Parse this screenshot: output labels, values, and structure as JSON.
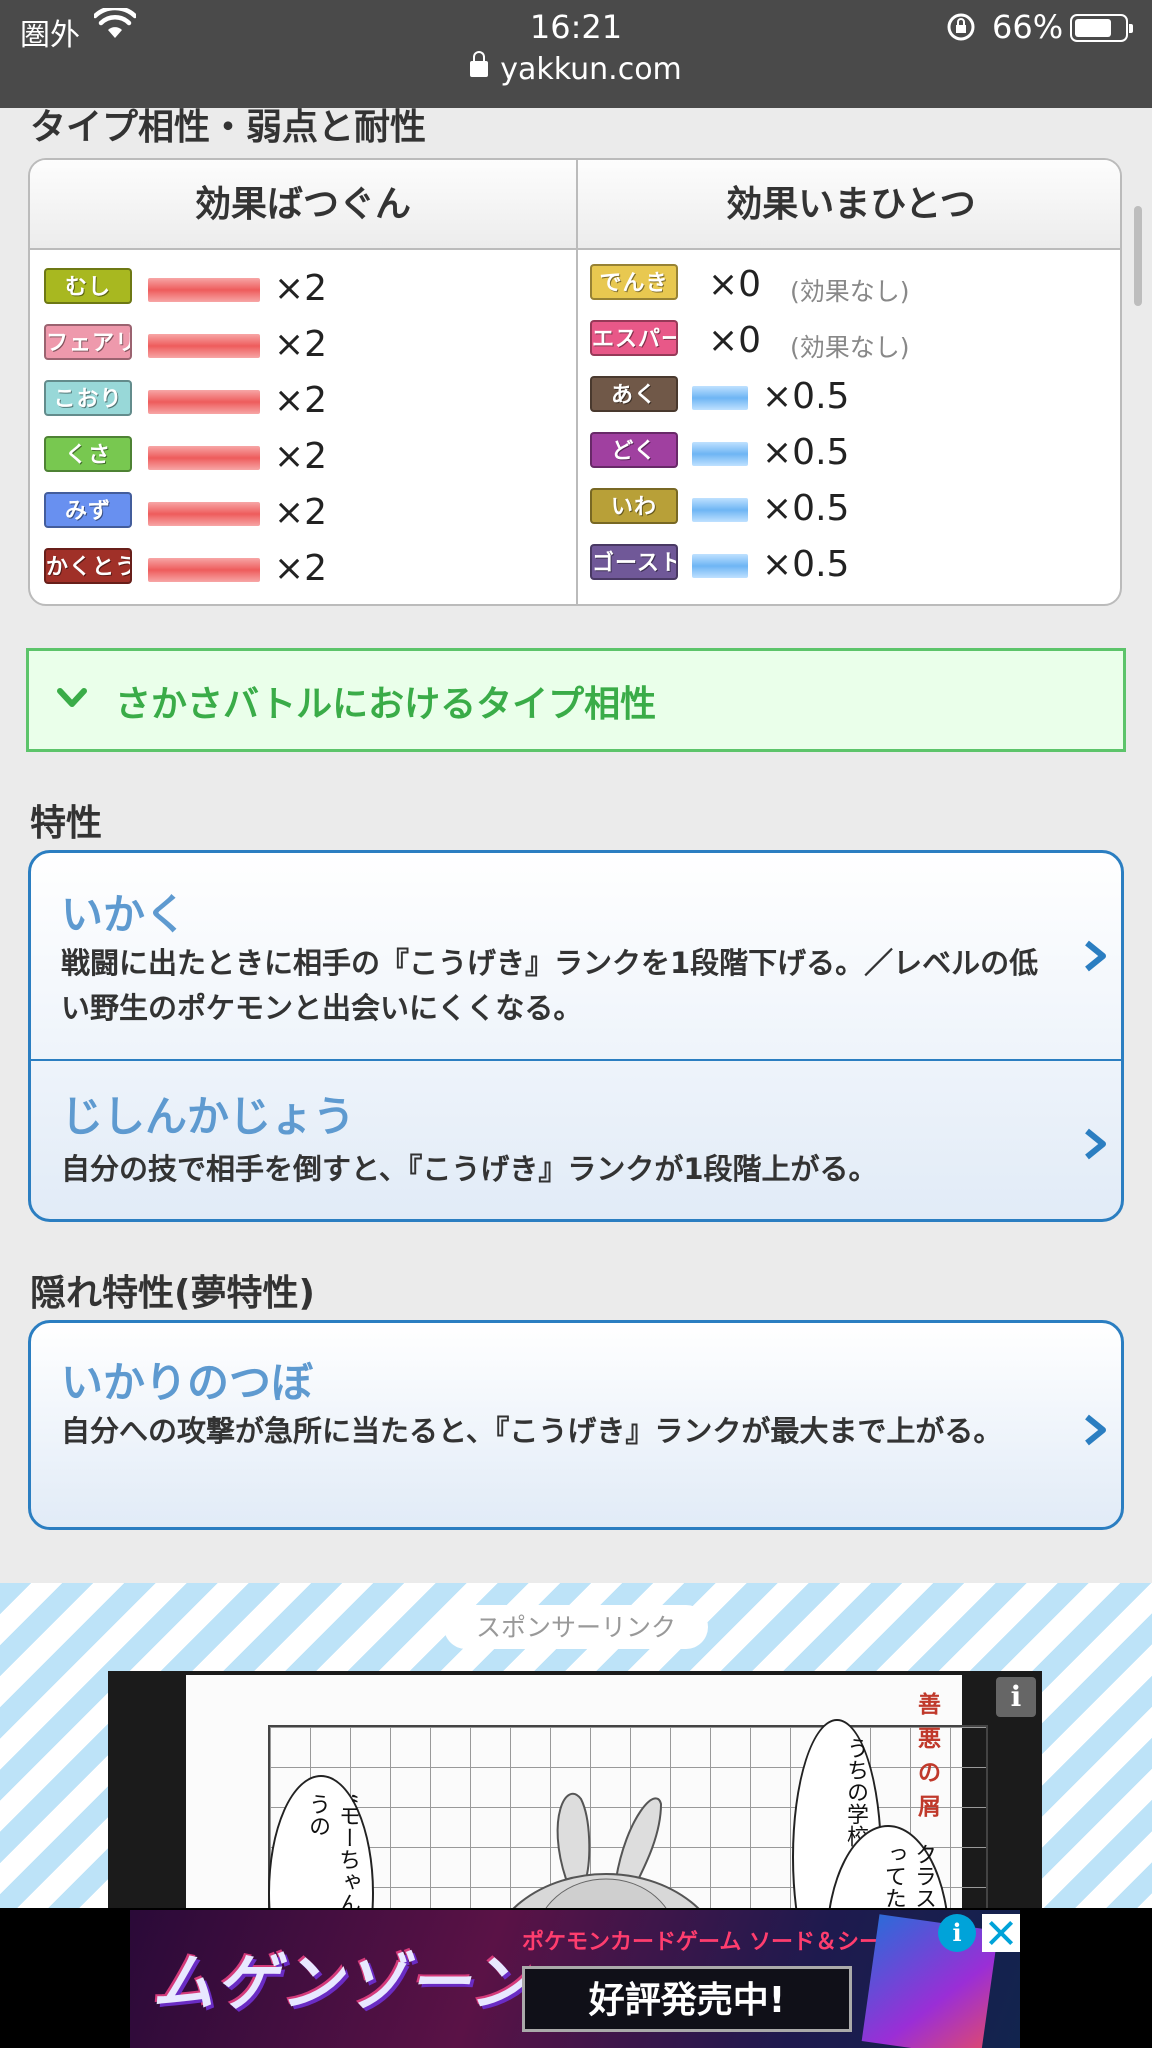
{
  "status_bar": {
    "carrier": "圏外",
    "time": "16:21",
    "battery": "66%",
    "url": "yakkun.com"
  },
  "type_section": {
    "title": "タイプ相性・弱点と耐性",
    "weak_header": "効果ばつぐん",
    "resist_header": "効果いまひとつ",
    "weak": [
      {
        "type": "むし",
        "color": "#a8b820",
        "mult": "×2",
        "bar": "red"
      },
      {
        "type": "フェアリー",
        "color": "#ee99ac",
        "mult": "×2",
        "bar": "red"
      },
      {
        "type": "こおり",
        "color": "#98d8d8",
        "mult": "×2",
        "bar": "red"
      },
      {
        "type": "くさ",
        "color": "#78c850",
        "mult": "×2",
        "bar": "red"
      },
      {
        "type": "みず",
        "color": "#6890f0",
        "mult": "×2",
        "bar": "red"
      },
      {
        "type": "かくとう",
        "color": "#a03028",
        "mult": "×2",
        "bar": "red"
      }
    ],
    "resist": [
      {
        "type": "でんき",
        "color": "#e8c850",
        "mult": "×0",
        "note": "(効果なし)"
      },
      {
        "type": "エスパー",
        "color": "#e85888",
        "mult": "×0",
        "note": "(効果なし)"
      },
      {
        "type": "あく",
        "color": "#705848",
        "mult": "×0.5",
        "note": ""
      },
      {
        "type": "どく",
        "color": "#a040a0",
        "mult": "×0.5",
        "note": ""
      },
      {
        "type": "いわ",
        "color": "#b8a038",
        "mult": "×0.5",
        "note": ""
      },
      {
        "type": "ゴースト",
        "color": "#705898",
        "mult": "×0.5",
        "note": ""
      }
    ]
  },
  "reverse_battle": {
    "label": "さかさバトルにおけるタイプ相性",
    "color": "#3aac48"
  },
  "abilities": {
    "title": "特性",
    "items": [
      {
        "name": "いかく",
        "desc": "戦闘に出たときに相手の『こうげき』ランクを1段階下げる。／レベルの低い野生のポケモンと出会いにくくなる。"
      },
      {
        "name": "じしんかじょう",
        "desc": "自分の技で相手を倒すと、『こうげき』ランクが1段階上がる。"
      }
    ]
  },
  "hidden_ability": {
    "title": "隠れ特性(夢特性)",
    "name": "いかりのつぼ",
    "desc": "自分への攻撃が急所に当たると、『こうげき』ランクが最大まで上がる。"
  },
  "sponsor": {
    "label": "スポンサーリンク",
    "ad_tag": "善悪の屑",
    "bubble_right": "うちの学校でね",
    "bubble_mid": "クラスのウサギを飼ってた",
    "bubble_left": "“モーちゃん”っていうの"
  },
  "banner": {
    "logo": "ムゲンゾーン",
    "subtitle": "ポケモンカードゲーム ソード＆シールド",
    "cta": "好評発売中!"
  }
}
